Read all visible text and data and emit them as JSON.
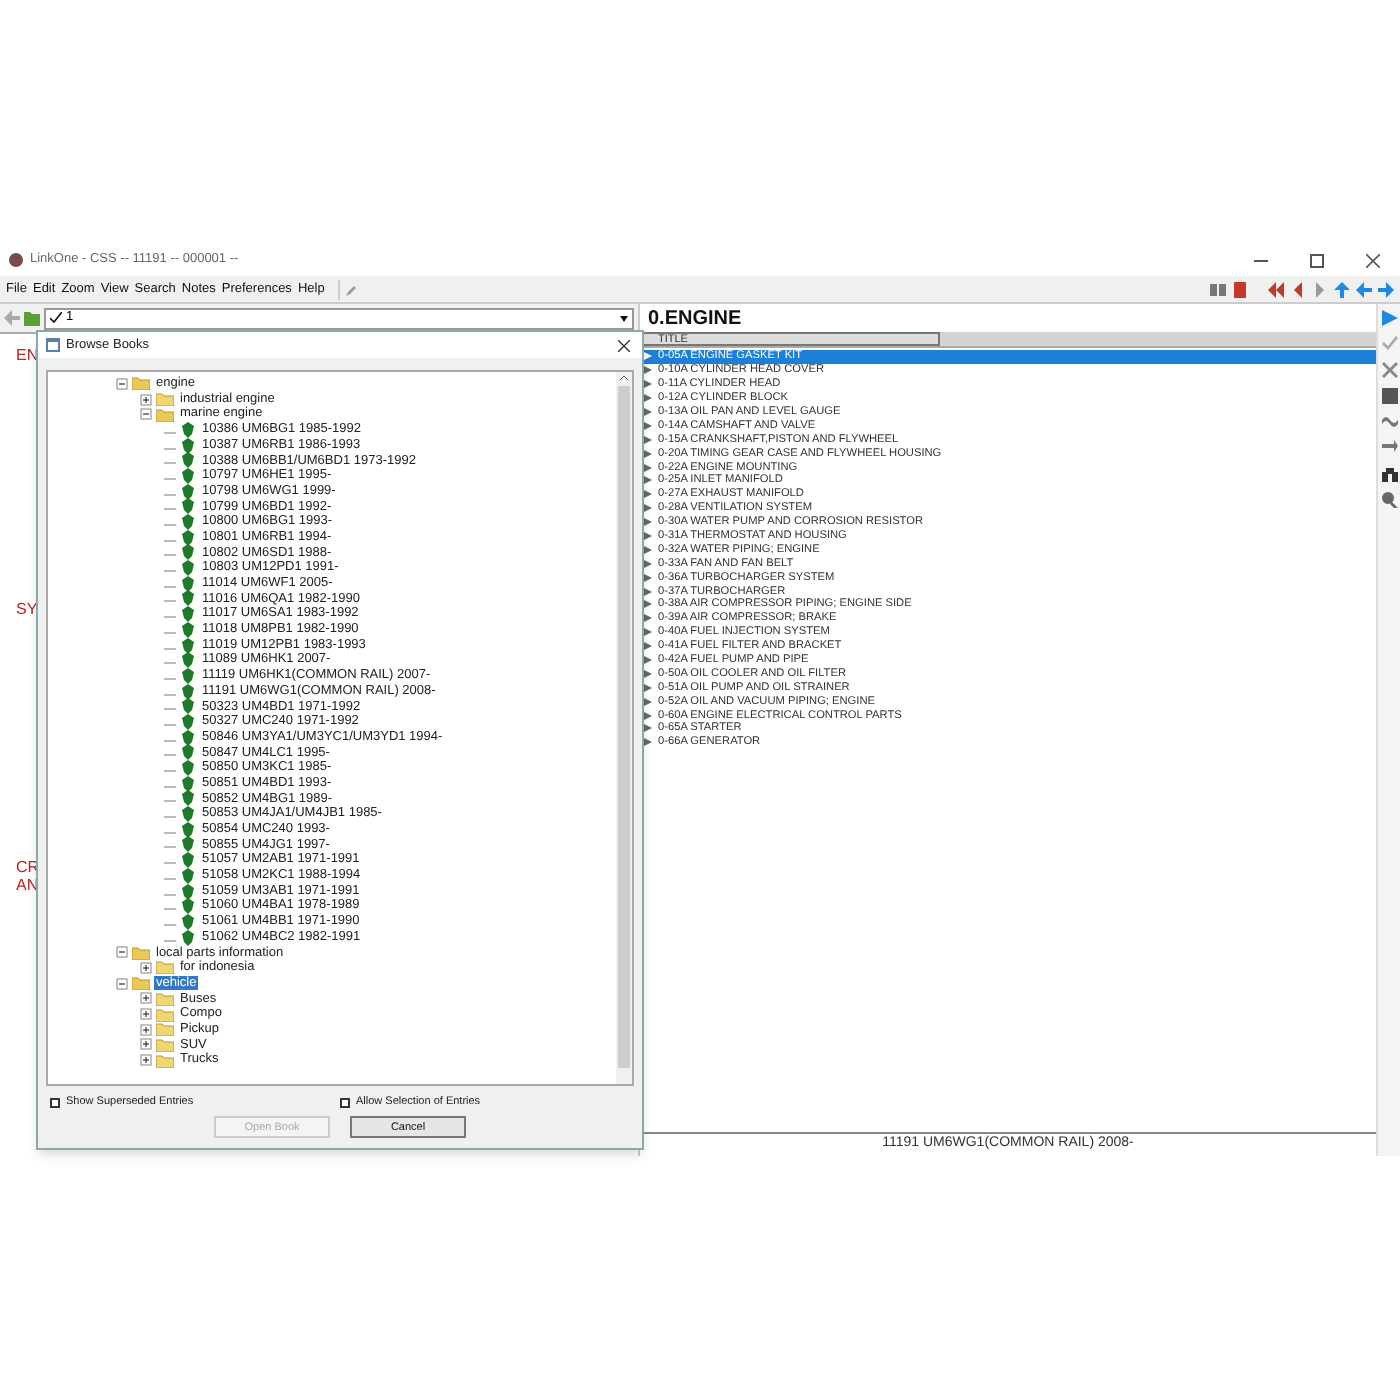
{
  "window": {
    "title": "LinkOne - CSS -- 11191 -- 000001 --"
  },
  "menu": [
    {
      "label": "File"
    },
    {
      "label": "Edit"
    },
    {
      "label": "Zoom"
    },
    {
      "label": "View"
    },
    {
      "label": "Search"
    },
    {
      "label": "Notes"
    },
    {
      "label": "Preferences"
    },
    {
      "label": "Help"
    }
  ],
  "selector": {
    "value": "1"
  },
  "left_pane_fragments": [
    "EN",
    "SY",
    "CR",
    "AN"
  ],
  "content": {
    "heading": "0.ENGINE",
    "column": "TITLE",
    "rows": [
      {
        "label": "0-05A ENGINE GASKET KIT",
        "selected": true
      },
      {
        "label": "0-10A CYLINDER HEAD COVER",
        "selected": false
      },
      {
        "label": "0-11A CYLINDER HEAD",
        "selected": false
      },
      {
        "label": "0-12A CYLINDER BLOCK",
        "selected": false
      },
      {
        "label": "0-13A OIL PAN AND LEVEL GAUGE",
        "selected": false
      },
      {
        "label": "0-14A CAMSHAFT AND VALVE",
        "selected": false
      },
      {
        "label": "0-15A CRANKSHAFT,PISTON AND FLYWHEEL",
        "selected": false
      },
      {
        "label": "0-20A TIMING GEAR CASE AND FLYWHEEL HOUSING",
        "selected": false
      },
      {
        "label": "0-22A ENGINE MOUNTING",
        "selected": false
      },
      {
        "label": "0-25A INLET MANIFOLD",
        "selected": false
      },
      {
        "label": "0-27A EXHAUST MANIFOLD",
        "selected": false
      },
      {
        "label": "0-28A VENTILATION SYSTEM",
        "selected": false
      },
      {
        "label": "0-30A WATER PUMP AND CORROSION RESISTOR",
        "selected": false
      },
      {
        "label": "0-31A THERMOSTAT AND HOUSING",
        "selected": false
      },
      {
        "label": "0-32A WATER PIPING; ENGINE",
        "selected": false
      },
      {
        "label": "0-33A FAN AND FAN BELT",
        "selected": false
      },
      {
        "label": "0-36A TURBOCHARGER SYSTEM",
        "selected": false
      },
      {
        "label": "0-37A TURBOCHARGER",
        "selected": false
      },
      {
        "label": "0-38A AIR COMPRESSOR PIPING; ENGINE SIDE",
        "selected": false
      },
      {
        "label": "0-39A AIR COMPRESSOR; BRAKE",
        "selected": false
      },
      {
        "label": "0-40A FUEL INJECTION SYSTEM",
        "selected": false
      },
      {
        "label": "0-41A FUEL FILTER AND BRACKET",
        "selected": false
      },
      {
        "label": "0-42A FUEL PUMP AND PIPE",
        "selected": false
      },
      {
        "label": "0-50A OIL COOLER AND OIL FILTER",
        "selected": false
      },
      {
        "label": "0-51A OIL PUMP AND OIL STRAINER",
        "selected": false
      },
      {
        "label": "0-52A OIL AND VACUUM PIPING; ENGINE",
        "selected": false
      },
      {
        "label": "0-60A ENGINE ELECTRICAL CONTROL PARTS",
        "selected": false
      },
      {
        "label": "0-65A STARTER",
        "selected": false
      },
      {
        "label": "0-66A GENERATOR",
        "selected": false
      }
    ]
  },
  "status_bar": "11191 UM6WG1(COMMON RAIL) 2008-",
  "dialog": {
    "title": "Browse Books",
    "tree": [
      {
        "kind": "folder",
        "label": "engine",
        "expanded": true,
        "selected": false,
        "children": [
          {
            "kind": "folder",
            "label": "industrial engine",
            "expanded": false,
            "selected": false
          },
          {
            "kind": "folder",
            "label": "marine engine",
            "expanded": true,
            "selected": false,
            "children": [
              {
                "kind": "book",
                "label": "10386 UM6BG1 1985-1992"
              },
              {
                "kind": "book",
                "label": "10387 UM6RB1 1986-1993"
              },
              {
                "kind": "book",
                "label": "10388 UM6BB1/UM6BD1 1973-1992"
              },
              {
                "kind": "book",
                "label": "10797 UM6HE1 1995-"
              },
              {
                "kind": "book",
                "label": "10798 UM6WG1 1999-"
              },
              {
                "kind": "book",
                "label": "10799 UM6BD1 1992-"
              },
              {
                "kind": "book",
                "label": "10800 UM6BG1 1993-"
              },
              {
                "kind": "book",
                "label": "10801 UM6RB1 1994-"
              },
              {
                "kind": "book",
                "label": "10802 UM6SD1 1988-"
              },
              {
                "kind": "book",
                "label": "10803 UM12PD1 1991-"
              },
              {
                "kind": "book",
                "label": "11014 UM6WF1 2005-"
              },
              {
                "kind": "book",
                "label": "11016 UM6QA1 1982-1990"
              },
              {
                "kind": "book",
                "label": "11017 UM6SA1 1983-1992"
              },
              {
                "kind": "book",
                "label": "11018 UM8PB1 1982-1990"
              },
              {
                "kind": "book",
                "label": "11019 UM12PB1 1983-1993"
              },
              {
                "kind": "book",
                "label": "11089 UM6HK1 2007-"
              },
              {
                "kind": "book",
                "label": "11119 UM6HK1(COMMON RAIL) 2007-"
              },
              {
                "kind": "book",
                "label": "11191 UM6WG1(COMMON RAIL) 2008-"
              },
              {
                "kind": "book",
                "label": "50323 UM4BD1 1971-1992"
              },
              {
                "kind": "book",
                "label": "50327 UMC240 1971-1992"
              },
              {
                "kind": "book",
                "label": "50846 UM3YA1/UM3YC1/UM3YD1 1994-"
              },
              {
                "kind": "book",
                "label": "50847 UM4LC1 1995-"
              },
              {
                "kind": "book",
                "label": "50850 UM3KC1 1985-"
              },
              {
                "kind": "book",
                "label": "50851 UM4BD1 1993-"
              },
              {
                "kind": "book",
                "label": "50852 UM4BG1 1989-"
              },
              {
                "kind": "book",
                "label": "50853 UM4JA1/UM4JB1 1985-"
              },
              {
                "kind": "book",
                "label": "50854 UMC240 1993-"
              },
              {
                "kind": "book",
                "label": "50855 UM4JG1 1997-"
              },
              {
                "kind": "book",
                "label": "51057 UM2AB1 1971-1991"
              },
              {
                "kind": "book",
                "label": "51058 UM2KC1 1988-1994"
              },
              {
                "kind": "book",
                "label": "51059 UM3AB1 1971-1991"
              },
              {
                "kind": "book",
                "label": "51060 UM4BA1 1978-1989"
              },
              {
                "kind": "book",
                "label": "51061 UM4BB1 1971-1990"
              },
              {
                "kind": "book",
                "label": "51062 UM4BC2 1982-1991"
              }
            ]
          }
        ]
      },
      {
        "kind": "folder",
        "label": "local parts information",
        "expanded": true,
        "selected": false,
        "children": [
          {
            "kind": "folder",
            "label": "for indonesia",
            "expanded": false,
            "selected": false
          }
        ]
      },
      {
        "kind": "folder",
        "label": "vehicle",
        "expanded": true,
        "selected": true,
        "children": [
          {
            "kind": "folder",
            "label": "Buses",
            "expanded": false,
            "selected": false
          },
          {
            "kind": "folder",
            "label": "Compo",
            "expanded": false,
            "selected": false
          },
          {
            "kind": "folder",
            "label": "Pickup",
            "expanded": false,
            "selected": false
          },
          {
            "kind": "folder",
            "label": "SUV",
            "expanded": false,
            "selected": false
          },
          {
            "kind": "folder",
            "label": "Trucks",
            "expanded": false,
            "selected": false
          }
        ]
      }
    ],
    "checkboxes": [
      {
        "label": "Show Superseded Entries",
        "checked": false
      },
      {
        "label": "Allow Selection of Entries",
        "checked": false
      }
    ],
    "buttons": [
      {
        "label": "Open Book",
        "disabled": true
      },
      {
        "label": "Cancel",
        "disabled": false
      }
    ]
  }
}
